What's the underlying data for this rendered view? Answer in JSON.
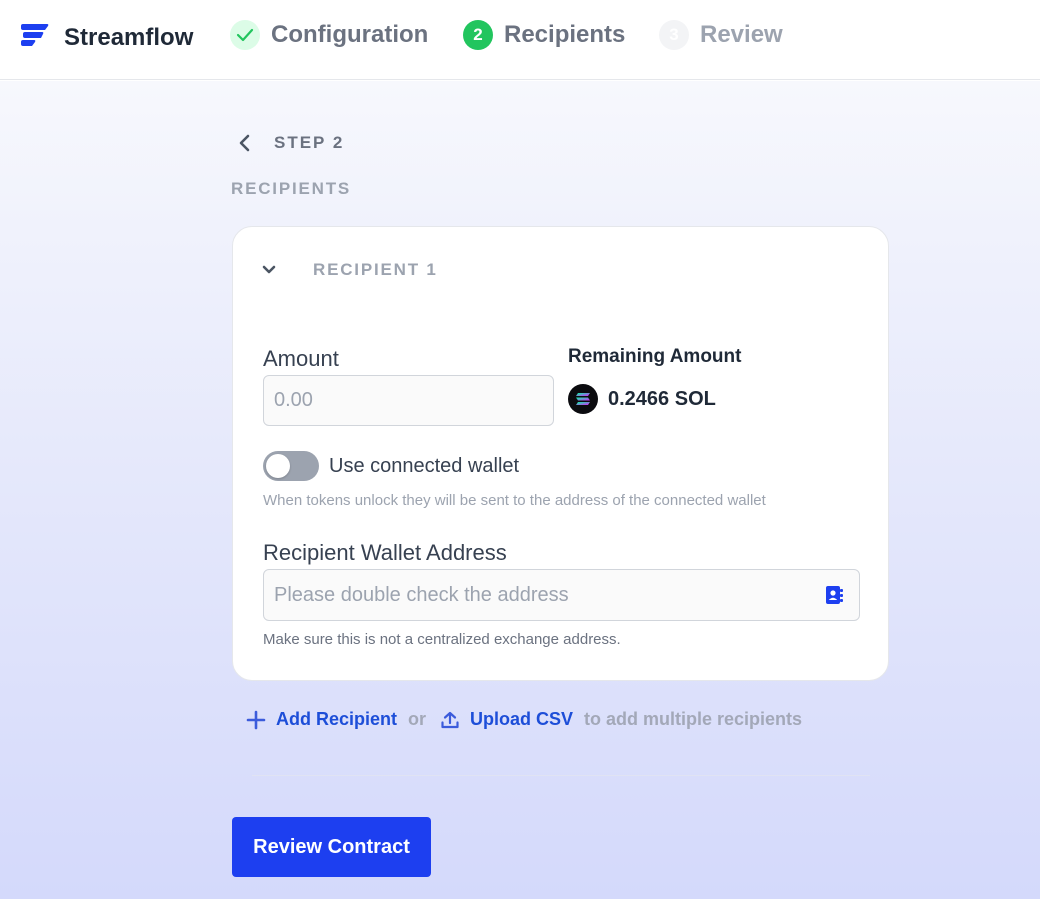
{
  "header": {
    "brand": "Streamflow",
    "steps": [
      {
        "number": "",
        "label": "Configuration",
        "state": "done"
      },
      {
        "number": "2",
        "label": "Recipients",
        "state": "active"
      },
      {
        "number": "3",
        "label": "Review",
        "state": "pending"
      }
    ]
  },
  "page": {
    "step_title": "STEP 2",
    "section_title": "RECIPIENTS"
  },
  "recipient": {
    "title": "RECIPIENT 1",
    "amount_label": "Amount",
    "amount_placeholder": "0.00",
    "amount_value": "",
    "remaining_label": "Remaining Amount",
    "remaining_value": "0.2466 SOL",
    "toggle_label": "Use connected wallet",
    "toggle_on": false,
    "toggle_help": "When tokens unlock they will be sent to the address of the connected wallet",
    "address_label": "Recipient Wallet Address",
    "address_placeholder": "Please double check the address",
    "address_value": "",
    "address_help": "Make sure this is not a centralized exchange address."
  },
  "actions": {
    "add_recipient": "Add Recipient",
    "or": "or",
    "upload_csv": "Upload CSV",
    "suffix": "to add multiple recipients"
  },
  "cta": {
    "label": "Review Contract"
  },
  "colors": {
    "primary": "#1d3ff0",
    "link": "#1d4ed8",
    "success": "#22c55e",
    "muted": "#9ca3af"
  }
}
